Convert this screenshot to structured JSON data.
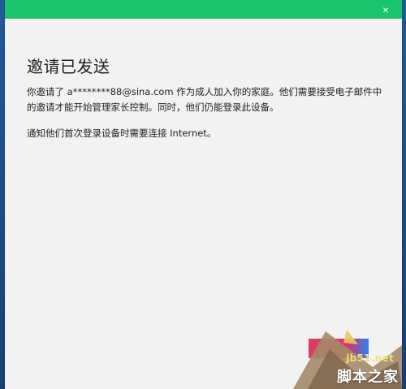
{
  "dialog": {
    "close_label": "×",
    "title": "邀请已发送",
    "message": "你邀请了 a********88@sina.com 作为成人加入你的家庭。他们需要接受电子邮件中的邀请才能开始管理家长控制。同时，他们仍能登录此设备。",
    "notice": "通知他们首次登录设备时需要连接 Internet。",
    "primary_action_label": ""
  },
  "watermark": {
    "site": "jb51.net",
    "name": "脚本之家"
  },
  "colors": {
    "titlebar": "#19c46b",
    "dialog_background": "#f2f2f2",
    "button_pink": "#d8346e",
    "button_blue": "#2d7ff6"
  },
  "icons": {
    "close": "close-icon",
    "watermark": "stylized-logo-icon"
  }
}
